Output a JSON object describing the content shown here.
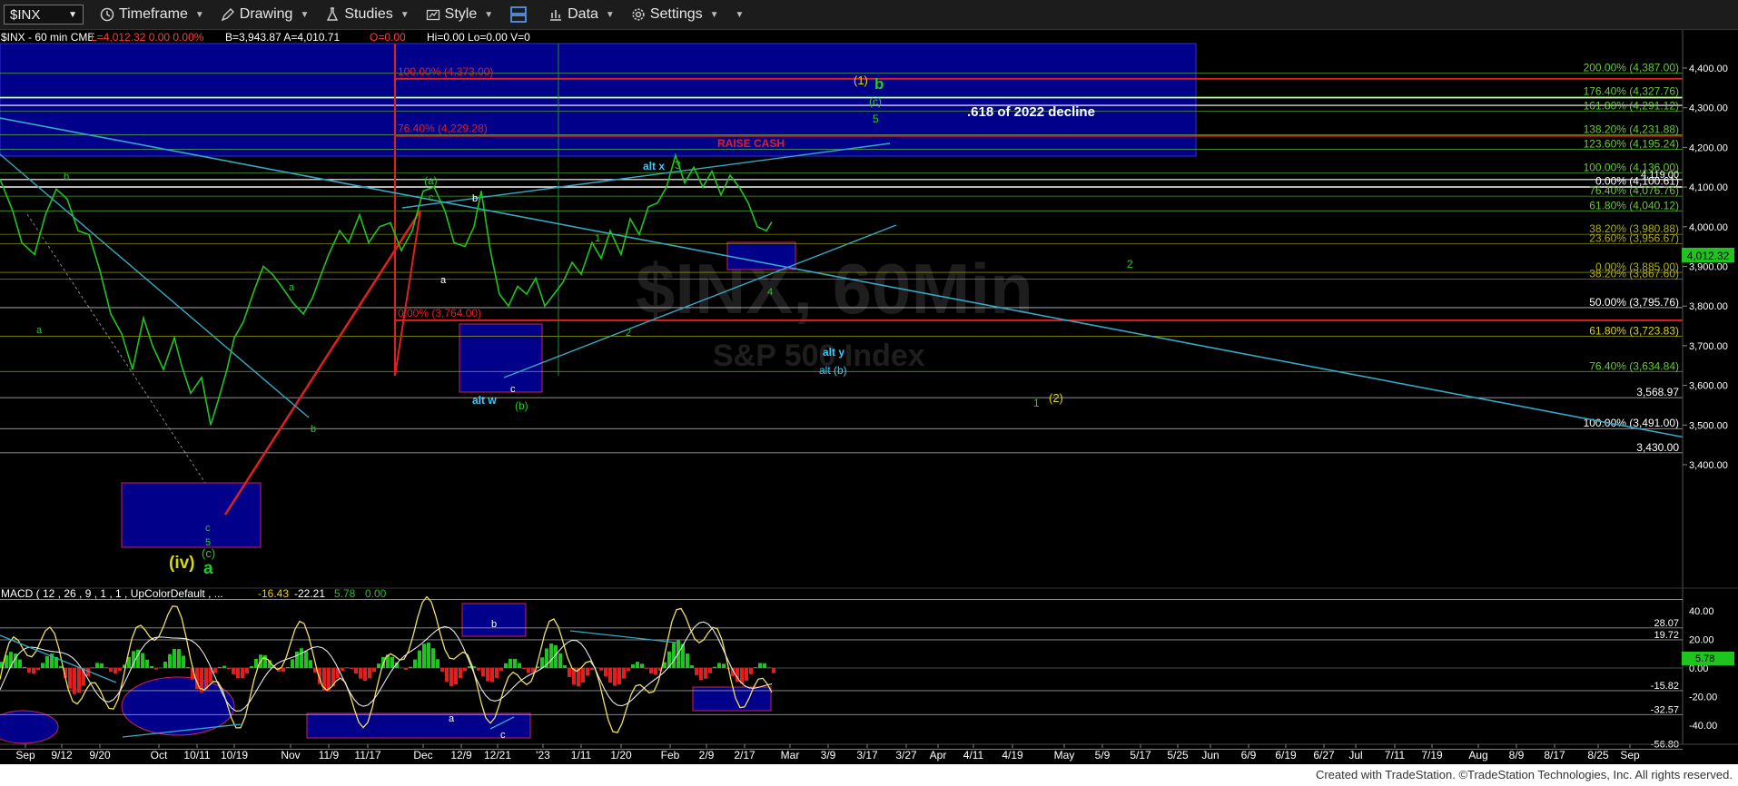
{
  "toolbar": {
    "symbol": "$INX",
    "timeframe": "Timeframe",
    "drawing": "Drawing",
    "studies": "Studies",
    "style": "Style",
    "data": "Data",
    "settings": "Settings"
  },
  "header_line": {
    "main": "$INX - 60 min  CME",
    "last": "L=4,012.32  0.00  0.00%",
    "bid_ask": "B=3,943.87  A=4,010.71",
    "o": "O=0.00",
    "hilo": "Hi=0.00  Lo=0.00  V=0"
  },
  "watermark": {
    "line1": "$INX, 60Min",
    "line2": "S&P 500 Index"
  },
  "footer": "Created with TradeStation. ©TradeStation Technologies, Inc. All rights reserved.",
  "chart_data": [
    {
      "type": "line",
      "name": "price",
      "y_axis": {
        "ticks": [
          3400,
          3500,
          3600,
          3700,
          3800,
          3900,
          4000,
          4100,
          4200,
          4300,
          4400
        ],
        "tick_labels": [
          "3,400.00",
          "3,500.00",
          "3,600.00",
          "3,700.00",
          "3,800.00",
          "3,900.00",
          "4,000.00",
          "4,100.00",
          "4,200.00",
          "4,300.00",
          "4,400.00"
        ],
        "range": [
          3348,
          4455
        ],
        "last_value_label": "4,012.32"
      },
      "x_axis": {
        "labels": [
          "Sep",
          "9/12",
          "9/20",
          "Oct",
          "10/11",
          "10/19",
          "Nov",
          "11/9",
          "11/17",
          "Dec",
          "12/9",
          "12/21",
          "'23",
          "1/11",
          "1/20",
          "Feb",
          "2/9",
          "2/17",
          "Mar",
          "3/9",
          "3/17",
          "3/27",
          "Apr",
          "4/11",
          "4/19",
          "May",
          "5/9",
          "5/17",
          "5/25",
          "Jun",
          "6/9",
          "6/19",
          "6/27",
          "Jul",
          "7/11",
          "7/19",
          "Aug",
          "8/9",
          "8/17",
          "8/25",
          "Sep"
        ],
        "label_px": [
          28,
          68,
          110,
          175,
          217,
          258,
          320,
          362,
          405,
          466,
          508,
          548,
          598,
          640,
          684,
          738,
          778,
          820,
          870,
          912,
          955,
          998,
          1033,
          1072,
          1115,
          1172,
          1214,
          1256,
          1297,
          1333,
          1375,
          1416,
          1458,
          1493,
          1536,
          1577,
          1628,
          1670,
          1712,
          1760,
          1795
        ]
      },
      "series_points": [
        [
          0,
          4120
        ],
        [
          14,
          4040
        ],
        [
          24,
          3960
        ],
        [
          38,
          3930
        ],
        [
          50,
          4030
        ],
        [
          62,
          4095
        ],
        [
          74,
          4070
        ],
        [
          86,
          3990
        ],
        [
          98,
          3980
        ],
        [
          110,
          3890
        ],
        [
          122,
          3780
        ],
        [
          134,
          3730
        ],
        [
          146,
          3640
        ],
        [
          158,
          3770
        ],
        [
          168,
          3700
        ],
        [
          180,
          3640
        ],
        [
          192,
          3720
        ],
        [
          200,
          3650
        ],
        [
          210,
          3580
        ],
        [
          222,
          3620
        ],
        [
          232,
          3500
        ],
        [
          240,
          3560
        ],
        [
          250,
          3640
        ],
        [
          258,
          3720
        ],
        [
          268,
          3760
        ],
        [
          280,
          3840
        ],
        [
          290,
          3900
        ],
        [
          300,
          3880
        ],
        [
          310,
          3850
        ],
        [
          322,
          3810
        ],
        [
          334,
          3780
        ],
        [
          344,
          3820
        ],
        [
          352,
          3870
        ],
        [
          362,
          3930
        ],
        [
          374,
          3990
        ],
        [
          384,
          3960
        ],
        [
          396,
          4030
        ],
        [
          406,
          3960
        ],
        [
          418,
          4000
        ],
        [
          430,
          4010
        ],
        [
          442,
          3940
        ],
        [
          454,
          3990
        ],
        [
          466,
          4090
        ],
        [
          478,
          4100
        ],
        [
          490,
          4040
        ],
        [
          500,
          3960
        ],
        [
          512,
          3950
        ],
        [
          522,
          4000
        ],
        [
          530,
          4090
        ],
        [
          540,
          3940
        ],
        [
          550,
          3830
        ],
        [
          560,
          3800
        ],
        [
          570,
          3850
        ],
        [
          580,
          3830
        ],
        [
          590,
          3870
        ],
        [
          600,
          3800
        ],
        [
          610,
          3830
        ],
        [
          620,
          3860
        ],
        [
          630,
          3910
        ],
        [
          640,
          3880
        ],
        [
          652,
          3960
        ],
        [
          662,
          3920
        ],
        [
          672,
          3990
        ],
        [
          684,
          3930
        ],
        [
          694,
          4020
        ],
        [
          704,
          3980
        ],
        [
          714,
          4050
        ],
        [
          724,
          4060
        ],
        [
          734,
          4100
        ],
        [
          744,
          4180
        ],
        [
          754,
          4110
        ],
        [
          764,
          4150
        ],
        [
          774,
          4100
        ],
        [
          784,
          4140
        ],
        [
          794,
          4080
        ],
        [
          804,
          4130
        ],
        [
          814,
          4100
        ],
        [
          824,
          4060
        ],
        [
          834,
          4000
        ],
        [
          844,
          3990
        ],
        [
          850,
          4012
        ]
      ],
      "fib_levels_left": [
        {
          "label": "100.00% (4,373.00)",
          "value": 4373
        },
        {
          "label": "76.40% (4,229.28)",
          "value": 4229
        },
        {
          "label": "0.00% (3,764.00)",
          "value": 3764
        }
      ],
      "fib_levels_right": [
        {
          "label": "200.00% (4,387.00)",
          "value": 4387
        },
        {
          "label": "176.40% (4,327.76)",
          "value": 4328
        },
        {
          "label": "161.80% (4,291.12)",
          "value": 4291
        },
        {
          "label": "138.20% (4,231.88)",
          "value": 4232
        },
        {
          "label": "123.60% (4,195.24)",
          "value": 4195
        },
        {
          "label": "100.00% (4,136.00)",
          "value": 4136
        },
        {
          "label": "0.00% (4,100.61)",
          "value": 4101
        },
        {
          "label": "76.40% (4,076.76)",
          "value": 4077
        },
        {
          "label": "61.80% (4,040.12)",
          "value": 4040
        },
        {
          "label": "38.20% (3,980.88)",
          "value": 3981
        },
        {
          "label": "23.60% (3,956.67)",
          "value": 3957
        },
        {
          "label": "0.00% (3,885.00)",
          "value": 3885
        },
        {
          "label": "38.20% (3,867.60)",
          "value": 3868
        },
        {
          "label": "50.00% (3,795.76)",
          "value": 3796
        },
        {
          "label": "61.80% (3,723.83)",
          "value": 3724
        },
        {
          "label": "76.40% (3,634.84)",
          "value": 3635
        },
        {
          "label": "3,568.97",
          "value": 3569
        },
        {
          "label": "100.00% (3,491.00)",
          "value": 3491
        },
        {
          "label": "3,430.00",
          "value": 3430
        }
      ],
      "extra_label": "4,119.00",
      "annotations": [
        {
          "text": "RAISE CASH",
          "color": "#e02020"
        },
        {
          "text": ".618 of 2022 decline",
          "color": "#ffffff"
        },
        {
          "text": "(1)",
          "color": "#d8d800"
        },
        {
          "text": "b",
          "color": "#22cc22"
        },
        {
          "text": "(c)",
          "color": "#22cc22"
        },
        {
          "text": "5",
          "color": "#22cc22"
        },
        {
          "text": "alt x",
          "color": "#33ccff"
        },
        {
          "text": "3",
          "color": "#22cc22"
        },
        {
          "text": "(a)",
          "color": "#22cc22"
        },
        {
          "text": "c",
          "color": "#22cc22"
        },
        {
          "text": "b",
          "color": "#ffffff"
        },
        {
          "text": "a",
          "color": "#ffffff"
        },
        {
          "text": "b",
          "color": "#22cc22"
        },
        {
          "text": "a",
          "color": "#22cc22"
        },
        {
          "text": "a",
          "color": "#22cc22"
        },
        {
          "text": "b",
          "color": "#22cc22"
        },
        {
          "text": "alt w",
          "color": "#33ccff"
        },
        {
          "text": "c",
          "color": "#ffffff"
        },
        {
          "text": "(b)",
          "color": "#22cc22"
        },
        {
          "text": "1",
          "color": "#22cc22"
        },
        {
          "text": "2",
          "color": "#22cc22"
        },
        {
          "text": "4",
          "color": "#22cc22"
        },
        {
          "text": "2",
          "color": "#22cc22"
        },
        {
          "text": "alt y",
          "color": "#33ccff"
        },
        {
          "text": "alt (b)",
          "color": "#33ccff"
        },
        {
          "text": "1",
          "color": "#22cc22"
        },
        {
          "text": "(2)",
          "color": "#d8d800"
        },
        {
          "text": "c",
          "color": "#22cc22"
        },
        {
          "text": "5",
          "color": "#22cc22"
        },
        {
          "text": "(c)",
          "color": "#22cc22"
        },
        {
          "text": "(iv)",
          "color": "#d8d800"
        },
        {
          "text": "a",
          "color": "#22cc22"
        }
      ]
    },
    {
      "type": "bar",
      "name": "MACD",
      "legend": {
        "label": "MACD ( 12 , 26 , 9 , 1 , 1 , UpColorDefault , ...",
        "v1": "-16.43",
        "v2": "-22.21",
        "v3": "5.78",
        "v4": "0.00"
      },
      "y_axis": {
        "ticks": [
          40,
          20,
          0,
          -20,
          -40
        ],
        "tick_labels": [
          "40.00",
          "20.00",
          "0.00",
          "-20.00",
          "-40.00"
        ],
        "range": [
          -60,
          50
        ]
      },
      "levels": [
        {
          "label": "28.07",
          "value": 28.07
        },
        {
          "label": "19.72",
          "value": 19.72
        },
        {
          "label": "-15.82",
          "value": -15.82
        },
        {
          "label": "-32.57",
          "value": -32.57
        },
        {
          "label": "-56.80",
          "value": -56.8
        }
      ],
      "last_value_label": "5.78",
      "annotations": [
        {
          "text": "b",
          "color": "#ffffff"
        },
        {
          "text": "a",
          "color": "#ffffff"
        },
        {
          "text": "c",
          "color": "#ffffff"
        }
      ]
    }
  ]
}
